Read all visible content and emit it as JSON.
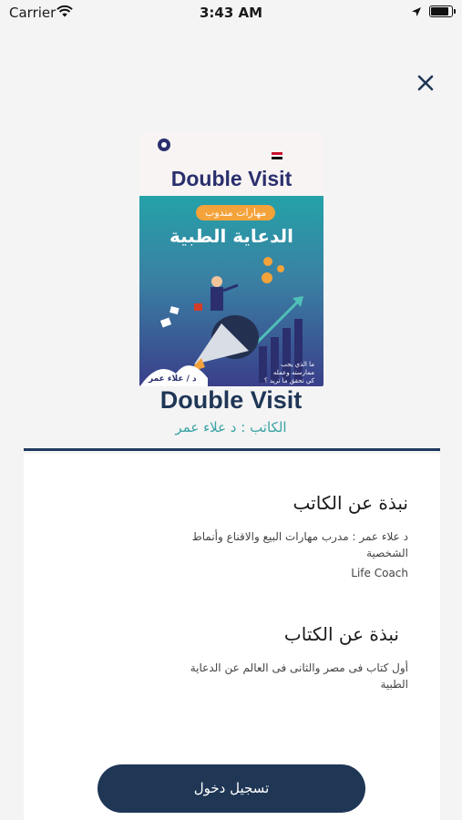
{
  "status_bar": {
    "carrier": "Carrier",
    "time": "3:43 AM"
  },
  "book": {
    "title": "Double Visit",
    "author_line": "الكاتب : د علاء عمر",
    "cover": {
      "title": "Double Visit",
      "pill": "مهارات مندوب",
      "headline": "الدعاية الطبية",
      "tagline": [
        "ما الذي يجب",
        "ممارسته وعمله",
        "كي تحقق ما تريد ؟"
      ],
      "author": "د / علاء عمر"
    }
  },
  "about_author": {
    "heading": "نبذة عن الكاتب",
    "text": "د علاء عمر : مدرب مهارات البيع والاقناع وأنماط الشخصية",
    "extra": "Life Coach"
  },
  "about_book": {
    "heading": "نبذة عن الكتاب",
    "text": "أول كتاب فى مصر والثانى فى العالم عن الدعاية الطبية"
  },
  "login_button": {
    "label": "تسجيل دخول"
  },
  "colors": {
    "primary": "#1f3655",
    "accent": "#3aa2a5"
  }
}
